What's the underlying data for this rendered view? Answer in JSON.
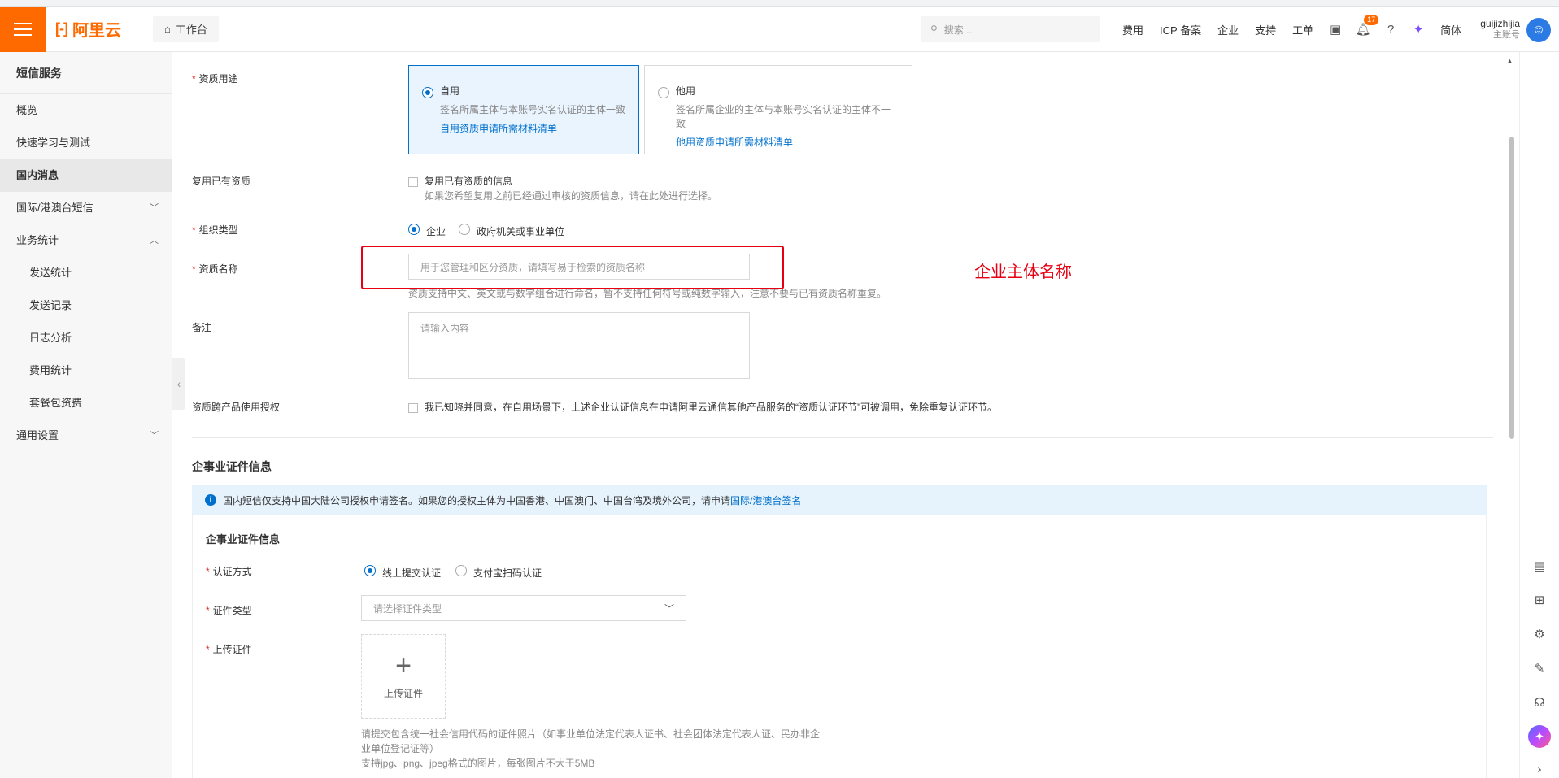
{
  "header": {
    "logo_mark": "[-]",
    "logo_text": "阿里云",
    "workbench": "工作台",
    "search_placeholder": "搜索...",
    "links": [
      "费用",
      "ICP 备案",
      "企业",
      "支持",
      "工单"
    ],
    "notification_count": "17",
    "language": "简体",
    "user_name": "guijizhijia",
    "user_role": "主账号"
  },
  "sidebar": {
    "title": "短信服务",
    "items": [
      {
        "label": "概览"
      },
      {
        "label": "快速学习与测试"
      },
      {
        "label": "国内消息"
      },
      {
        "label": "国际/港澳台短信"
      },
      {
        "label": "业务统计"
      },
      {
        "label": "发送统计"
      },
      {
        "label": "发送记录"
      },
      {
        "label": "日志分析"
      },
      {
        "label": "费用统计"
      },
      {
        "label": "套餐包资费"
      },
      {
        "label": "通用设置"
      }
    ]
  },
  "form": {
    "usage_label": "资质用途",
    "self_use": {
      "title": "自用",
      "desc": "签名所属主体与本账号实名认证的主体一致",
      "link": "自用资质申请所需材料清单"
    },
    "other_use": {
      "title": "他用",
      "desc": "签名所属企业的主体与本账号实名认证的主体不一致",
      "link": "他用资质申请所需材料清单"
    },
    "reuse_label": "复用已有资质",
    "reuse_checkbox": "复用已有资质的信息",
    "reuse_hint": "如果您希望复用之前已经通过审核的资质信息，请在此处进行选择。",
    "org_type_label": "组织类型",
    "org_enterprise": "企业",
    "org_gov": "政府机关或事业单位",
    "name_label": "资质名称",
    "name_placeholder": "用于您管理和区分资质，请填写易于检索的资质名称",
    "name_hint": "资质支持中文、英文或与数字组合进行命名，暂不支持任何符号或纯数字输入，注意不要与已有资质名称重复。",
    "remark_label": "备注",
    "remark_placeholder": "请输入内容",
    "auth_label": "资质跨产品使用授权",
    "auth_checkbox": "我已知晓并同意，在自用场景下，上述企业认证信息在申请阿里云通信其他产品服务的“资质认证环节”可被调用，免除重复认证环节。"
  },
  "annotation": "企业主体名称",
  "cert": {
    "section_title": "企事业证件信息",
    "info_text": "国内短信仅支持中国大陆公司授权申请签名。如果您的授权主体为中国香港、中国澳门、中国台湾及境外公司，请申请",
    "info_link": "国际/港澳台签名",
    "inner_title": "企事业证件信息",
    "method_label": "认证方式",
    "method_online": "线上提交认证",
    "method_alipay": "支付宝扫码认证",
    "type_label": "证件类型",
    "type_placeholder": "请选择证件类型",
    "upload_label": "上传证件",
    "upload_btn": "上传证件",
    "upload_hint1": "请提交包含统一社会信用代码的证件照片（如事业单位法定代表人证书、社会团体法定代表人证、民办非企",
    "upload_hint2": "业单位登记证等）",
    "upload_hint3": "支持jpg、png、jpeg格式的图片，每张图片不大于5MB"
  }
}
